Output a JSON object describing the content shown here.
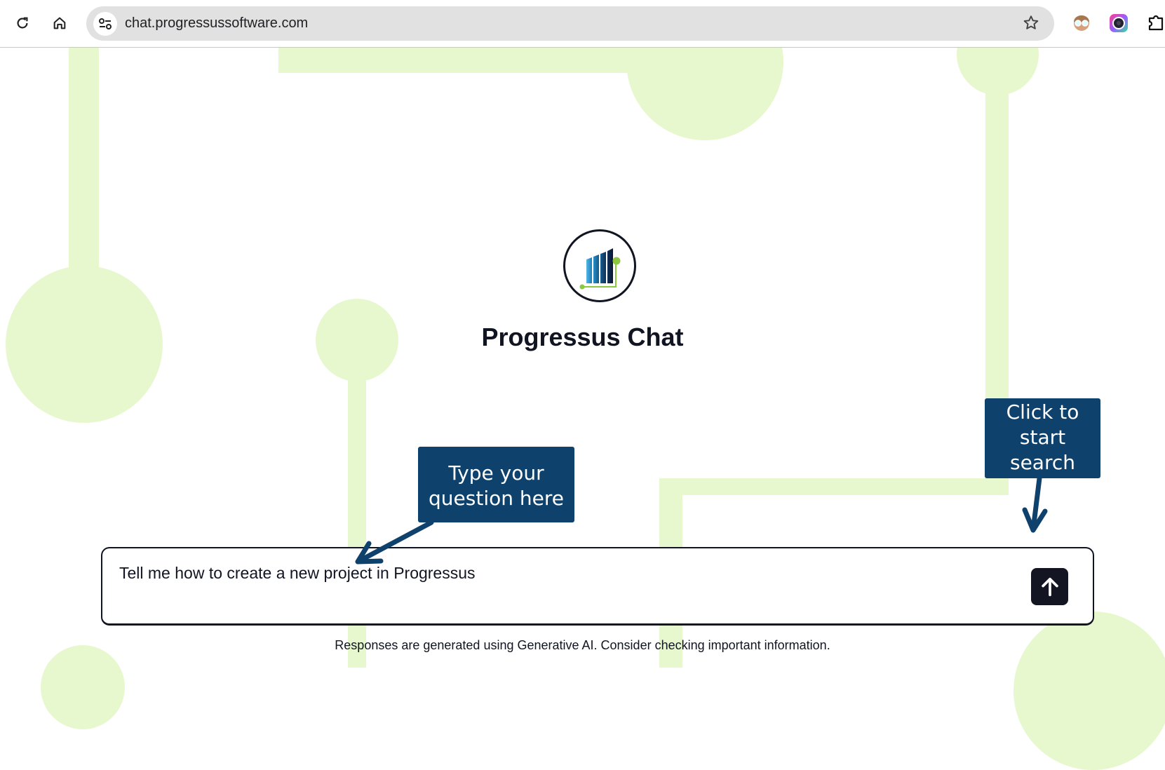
{
  "browser": {
    "url": "chat.progressussoftware.com",
    "icons": [
      "reload-icon",
      "home-icon",
      "site-info-icon",
      "bookmark-star-icon",
      "extension-avatar-icon",
      "extension-camera-icon",
      "extensions-puzzle-icon"
    ]
  },
  "colors": {
    "decoration": "#e8f8ce",
    "callout": "#0e416b",
    "dark": "#111522",
    "logo_accent": "#8dc63f"
  },
  "app": {
    "title": "Progressus Chat",
    "logo": "progressus-logo"
  },
  "callouts": {
    "type_question": "Type your question here",
    "start_search_line1": "Click to",
    "start_search_line2": "start",
    "start_search_line3": "search"
  },
  "chat": {
    "input_value": "Tell me how to create a new project in Progressus",
    "send_icon": "arrow-up-icon"
  },
  "footer": {
    "disclaimer": "Responses are generated using Generative AI. Consider checking important information."
  }
}
